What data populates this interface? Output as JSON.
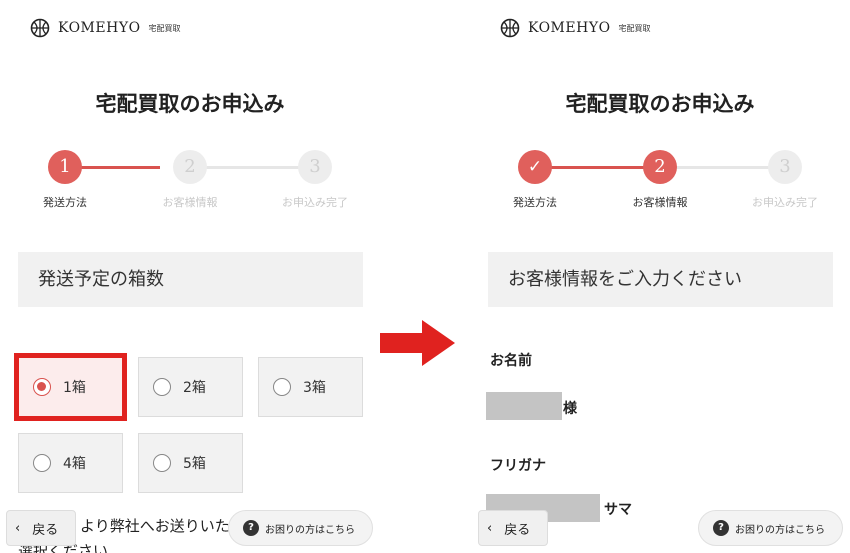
{
  "left": {
    "brand": "KOMEHYO",
    "brand_sub": "宅配買取",
    "page_title": "宅配買取のお申込み",
    "steps": [
      {
        "num": "1",
        "label": "発送方法"
      },
      {
        "num": "2",
        "label": "お客様情報"
      },
      {
        "num": "3",
        "label": "お申込み完了"
      }
    ],
    "section_title": "発送予定の箱数",
    "box_options": [
      "1箱",
      "2箱",
      "3箱",
      "4箱",
      "5箱"
    ],
    "selected_box": "1箱",
    "partial_text_1": "より弊社へお送りいた",
    "partial_text_2": "選択ください",
    "back_label": "戻る",
    "help_label": "お困りの方はこちら"
  },
  "right": {
    "brand": "KOMEHYO",
    "brand_sub": "宅配買取",
    "page_title": "宅配買取のお申込み",
    "steps": [
      {
        "num": "✓",
        "label": "発送方法"
      },
      {
        "num": "2",
        "label": "お客様情報"
      },
      {
        "num": "3",
        "label": "お申込み完了"
      }
    ],
    "section_title": "お客様情報をご入力ください",
    "name_label": "お名前",
    "name_suffix": "様",
    "furigana_label": "フリガナ",
    "furigana_suffix": "サマ",
    "back_label": "戻る",
    "help_label": "お困りの方はこちら"
  },
  "colors": {
    "accent": "#e0605c",
    "highlight": "#e0221f",
    "arrow": "#e0221f"
  }
}
